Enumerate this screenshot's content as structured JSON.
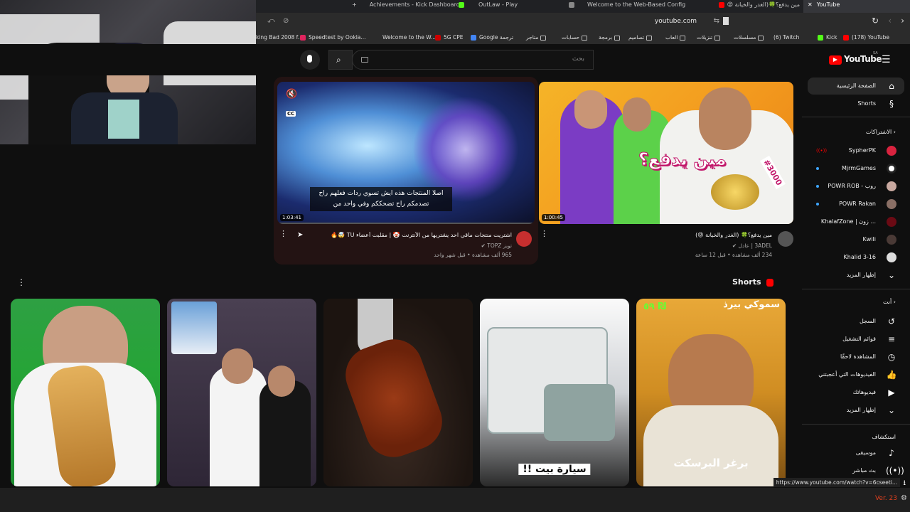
{
  "browser": {
    "tabs": [
      {
        "label": "Achievements - Kick Dashboard",
        "color": "#53fc18"
      },
      {
        "label": "OutLaw - Play",
        "color": "#53fc18"
      },
      {
        "label": "Welcome to the Web-Based Config",
        "color": "#888888"
      },
      {
        "label": "مين يدفع؟🍀(الغدر والخيانة 😡",
        "color": "#ff0000"
      },
      {
        "label": "YouTube",
        "color": "#ff0000"
      }
    ],
    "url": "youtube.com",
    "bookmarks": [
      "king Bad 2008 f...",
      "Speedtest by Ookla...",
      "Welcome to the W...",
      "5G CPE",
      "Google ترجمة",
      "متاجر",
      "حسابات",
      "برمجة",
      "تصاميم",
      "العاب",
      "تنزيلات",
      "مسلسلات",
      "(6) Twitch",
      "Kick",
      "(178) YouTube"
    ]
  },
  "youtube": {
    "logo": "YouTube",
    "region": "SA",
    "search_placeholder": "بحث",
    "sidebar": {
      "home": "الصفحة الرئيسية",
      "shorts": "Shorts",
      "subscriptions_heading": "الاشتراكات",
      "channels": [
        "SypherPK",
        "MjrmGames",
        "POWR ROB - روب",
        "POWR Rakan",
        "KhalafZone | زون ...",
        "Kwili",
        "Khalid 3-16"
      ],
      "show_more": "إظهار المزيد",
      "you_heading": "أنت",
      "you_items": [
        "السجل",
        "قوائم التشغيل",
        "المشاهدة لاحقًا",
        "الفيديوهات التي أعجبتني",
        "فيديوهاتك"
      ],
      "show_more_2": "إظهار المزيد",
      "explore_heading": "استكشاف",
      "explore_items": [
        "موسيقى",
        "بث مباشر"
      ]
    },
    "videos": [
      {
        "title": "مين يدفع؟🍀 (الغدر والخيانة 😡)",
        "channel": "3ADEL | عادل",
        "meta": "234 ألف مشاهدة • قبل 12 ساعة",
        "duration": "1:00:45"
      },
      {
        "title": "اشتريت منتجات ماقي احد يشتريها من الأنترنت 🤡 | مقلبت أعضاء TU 🤯🔥",
        "channel": "توبز TOPZ",
        "meta": "965 ألف مشاهدة • قبل شهر واحد",
        "duration": "1:03:41",
        "subtitle": "اصلا المنتجات هذه ايش تسوي ردات فعلهم راح تصدمكم راح تضحككم وفي واحد من"
      }
    ],
    "thumb_text": {
      "who_pays": "مين يدفع؟",
      "price": "#3000"
    },
    "shorts_heading": "Shorts",
    "shorts": [
      {
        "caption": "",
        "top_text": ""
      },
      {
        "caption": "",
        "top_text": ""
      },
      {
        "caption": "",
        "top_text": ""
      },
      {
        "caption": "سيارة بيت !!",
        "top_text": ""
      },
      {
        "caption": "برغر البرسكت",
        "top_text": "سموكي بيرذ",
        "price_text": "٥٩ ₪"
      }
    ],
    "status_url": "https://www.youtube.com/watch?v=6cseeti...",
    "version": "Ver. 23"
  }
}
